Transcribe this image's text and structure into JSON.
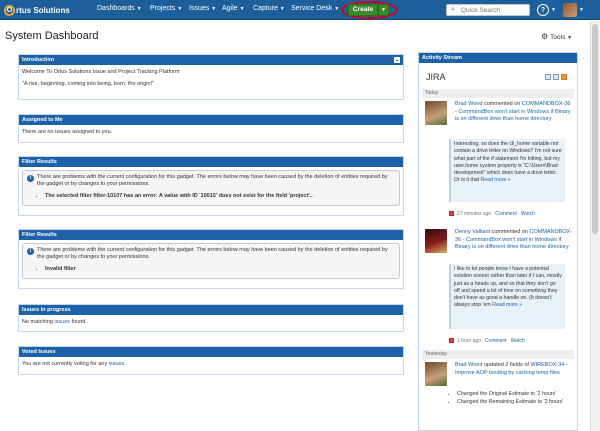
{
  "nav": {
    "logo_letter": "O",
    "logo_text": "rtus Solutions",
    "items": [
      "Dashboards",
      "Projects",
      "Issues",
      "Agile",
      "Capture",
      "Service Desk"
    ],
    "create_label": "Create",
    "search_placeholder": "Quick Search",
    "help_label": "?"
  },
  "page": {
    "title": "System Dashboard",
    "tools_label": "Tools"
  },
  "gadgets": {
    "intro": {
      "title": "Introduction",
      "line1": "Welcome To Ortus Solutions Issue and Project Tracking Platform",
      "line2": "\"A rise, beginning, coming into being, born, the origin!\""
    },
    "assigned": {
      "title": "Assigned to Me",
      "text": "There are no issues assigned to you."
    },
    "filter1": {
      "title": "Filter Results",
      "message": "There are problems with the current configuration for this gadget. The errors below may have been caused by the deletion of entities required by the gadget or by changes to your permissions.",
      "error": "The selected filter filter-10107 has an error: A value with ID '10015' does not exist for the field 'project'.."
    },
    "filter2": {
      "title": "Filter Results",
      "message": "There are problems with the current configuration for this gadget. The errors below may have been caused by the deletion of entities required by the gadget or by changes to your permissions.",
      "error": "Invalid filter"
    },
    "progress": {
      "title": "Issues in progress",
      "text_before": "No matching",
      "link": "issues",
      "text_after": "found."
    },
    "voted": {
      "title": "Voted Issues",
      "text_before": "You are not currently voting for any",
      "link": "issues",
      "text_after": "."
    }
  },
  "activity": {
    "title": "Activity Stream",
    "source": "JIRA",
    "today_label": "Today",
    "yesterday_label": "Yesterday",
    "entries": [
      {
        "user": "Brad Wood",
        "action": "commented on",
        "issue": "COMMANDBOX-36 - CommandBox won't start in Windows if Binary is on different drive than home directory",
        "quote": "Interesting, so does the cli_home variable not contain a drive letter on Windows? I'm not sure what part of the if statement I'm hitting, but my user.home system property is \"C:\\Users\\Brad development\" which does have a drive letter. Or is it that",
        "read_more": "Read more »",
        "time": "27 minutes ago",
        "comment_label": "Comment",
        "watch_label": "Watch"
      },
      {
        "user": "Denny Valliant",
        "action": "commented on",
        "issue": "COMMANDBOX-36 - CommandBox won't start in Windows if Binary is on different drive than home directory",
        "quote": "I like to let people know I have a potential solution sooner rather than later if I can, mostly just as a heads up, and so that they don't go off and spend a lot of time on something they don't have as good a handle on. (It doesn't always stop 'em",
        "read_more": "Read more »",
        "time": "1 hour ago",
        "comment_label": "Comment",
        "watch_label": "Watch"
      },
      {
        "user": "Brad Wood",
        "action": "updated 2 fields of",
        "issue": "WIREBOX-34 - Improve AOP binding by caching temp files",
        "changes": [
          "Changed the Original Estimate to '2 hours'",
          "Changed the Remaining Estimate to '2 hours'"
        ]
      }
    ]
  },
  "colors": {
    "nav_bg": "#1c5f9b",
    "gadget_header": "#1d62a8",
    "create_green": "#3b8d2b",
    "annotation_red": "#d0021b"
  }
}
